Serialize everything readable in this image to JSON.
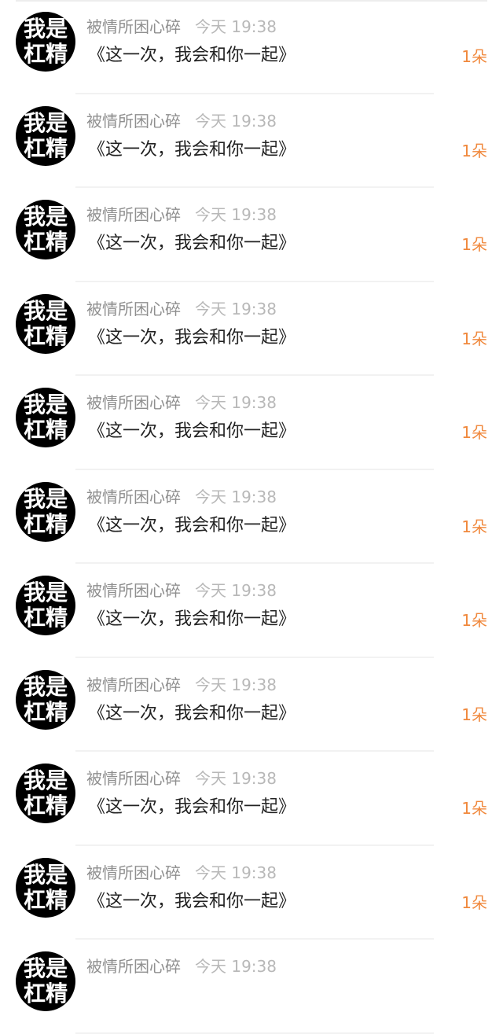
{
  "colors": {
    "avatar_background": "#000000",
    "avatar_text": "#ffffff",
    "name_text": "#8f8f8f",
    "time_text": "#b8b8b8",
    "message_text": "#222222",
    "count_text": "#f0883c"
  },
  "rows": [
    {
      "avatar_line1": "我是",
      "avatar_line2": "杠精",
      "name": "被情所困心碎",
      "time": "今天 19:38",
      "message": "《这一次，我会和你一起》",
      "count": "1朵"
    },
    {
      "avatar_line1": "我是",
      "avatar_line2": "杠精",
      "name": "被情所困心碎",
      "time": "今天 19:38",
      "message": "《这一次，我会和你一起》",
      "count": "1朵"
    },
    {
      "avatar_line1": "我是",
      "avatar_line2": "杠精",
      "name": "被情所困心碎",
      "time": "今天 19:38",
      "message": "《这一次，我会和你一起》",
      "count": "1朵"
    },
    {
      "avatar_line1": "我是",
      "avatar_line2": "杠精",
      "name": "被情所困心碎",
      "time": "今天 19:38",
      "message": "《这一次，我会和你一起》",
      "count": "1朵"
    },
    {
      "avatar_line1": "我是",
      "avatar_line2": "杠精",
      "name": "被情所困心碎",
      "time": "今天 19:38",
      "message": "《这一次，我会和你一起》",
      "count": "1朵"
    },
    {
      "avatar_line1": "我是",
      "avatar_line2": "杠精",
      "name": "被情所困心碎",
      "time": "今天 19:38",
      "message": "《这一次，我会和你一起》",
      "count": "1朵"
    },
    {
      "avatar_line1": "我是",
      "avatar_line2": "杠精",
      "name": "被情所困心碎",
      "time": "今天 19:38",
      "message": "《这一次，我会和你一起》",
      "count": "1朵"
    },
    {
      "avatar_line1": "我是",
      "avatar_line2": "杠精",
      "name": "被情所困心碎",
      "time": "今天 19:38",
      "message": "《这一次，我会和你一起》",
      "count": "1朵"
    },
    {
      "avatar_line1": "我是",
      "avatar_line2": "杠精",
      "name": "被情所困心碎",
      "time": "今天 19:38",
      "message": "《这一次，我会和你一起》",
      "count": "1朵"
    },
    {
      "avatar_line1": "我是",
      "avatar_line2": "杠精",
      "name": "被情所困心碎",
      "time": "今天 19:38",
      "message": "《这一次，我会和你一起》",
      "count": "1朵"
    },
    {
      "avatar_line1": "我是",
      "avatar_line2": "杠精",
      "name": "被情所困心碎",
      "time": "今天 19:38",
      "message": "",
      "count": ""
    }
  ]
}
